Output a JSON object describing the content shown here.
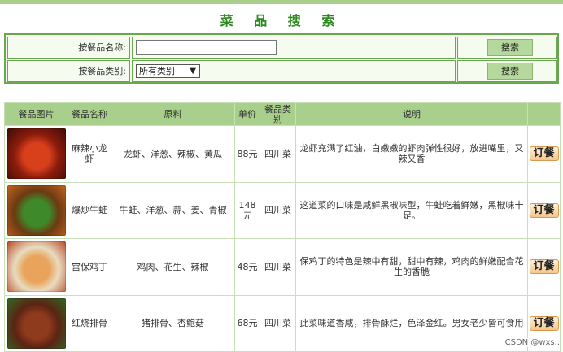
{
  "page": {
    "title": "菜 品 搜 索"
  },
  "search": {
    "name_label": "按餐品名称:",
    "name_value": "",
    "category_label": "按餐品类别:",
    "category_selected": "所有类别",
    "search_button": "搜索"
  },
  "table": {
    "headers": [
      "餐品图片",
      "餐品名称",
      "原料",
      "单价",
      "餐品类别",
      "说明",
      ""
    ],
    "rows": [
      {
        "name": "麻辣小龙虾",
        "ingredients": "龙虾、洋葱、辣椒、黄瓜",
        "price": "88元",
        "category": "四川菜",
        "description": "龙虾充满了红油，白嫩嫩的虾肉弹性很好，放进嘴里，又辣又香",
        "action": "订餐",
        "image_colors": [
          "#8b1c0c",
          "#d8401c",
          "#3c0d06"
        ]
      },
      {
        "name": "爆炒牛蛙",
        "ingredients": "牛蛙、洋葱、蒜、姜、青椒",
        "price": "148元",
        "category": "四川菜",
        "description": "这道菜的口味是咸鲜黑椒味型，牛蛙吃着鲜嫩，黑椒味十足。",
        "action": "订餐",
        "image_colors": [
          "#6b3a12",
          "#3e8a2a",
          "#c5651f"
        ]
      },
      {
        "name": "宫保鸡丁",
        "ingredients": "鸡肉、花生、辣椒",
        "price": "48元",
        "category": "四川菜",
        "description": "保鸡丁的特色是辣中有甜，甜中有辣，鸡肉的鲜嫩配合花生的香脆",
        "action": "订餐",
        "image_colors": [
          "#e8dcc0",
          "#e9a35a",
          "#b8492a"
        ]
      },
      {
        "name": "红烧排骨",
        "ingredients": "猪排骨、杏鲍菇",
        "price": "68元",
        "category": "四川菜",
        "description": "此菜味道香咸，排骨酥烂，色泽金红。男女老少皆可食用",
        "action": "订餐",
        "image_colors": [
          "#5a2414",
          "#8e3a1c",
          "#2f6b24"
        ]
      }
    ]
  },
  "watermark": "CSDN @wxs..",
  "colors": {
    "accent_green": "#a9cf8c",
    "title_green": "#2b8a1f",
    "border_green": "#6aa84f"
  }
}
